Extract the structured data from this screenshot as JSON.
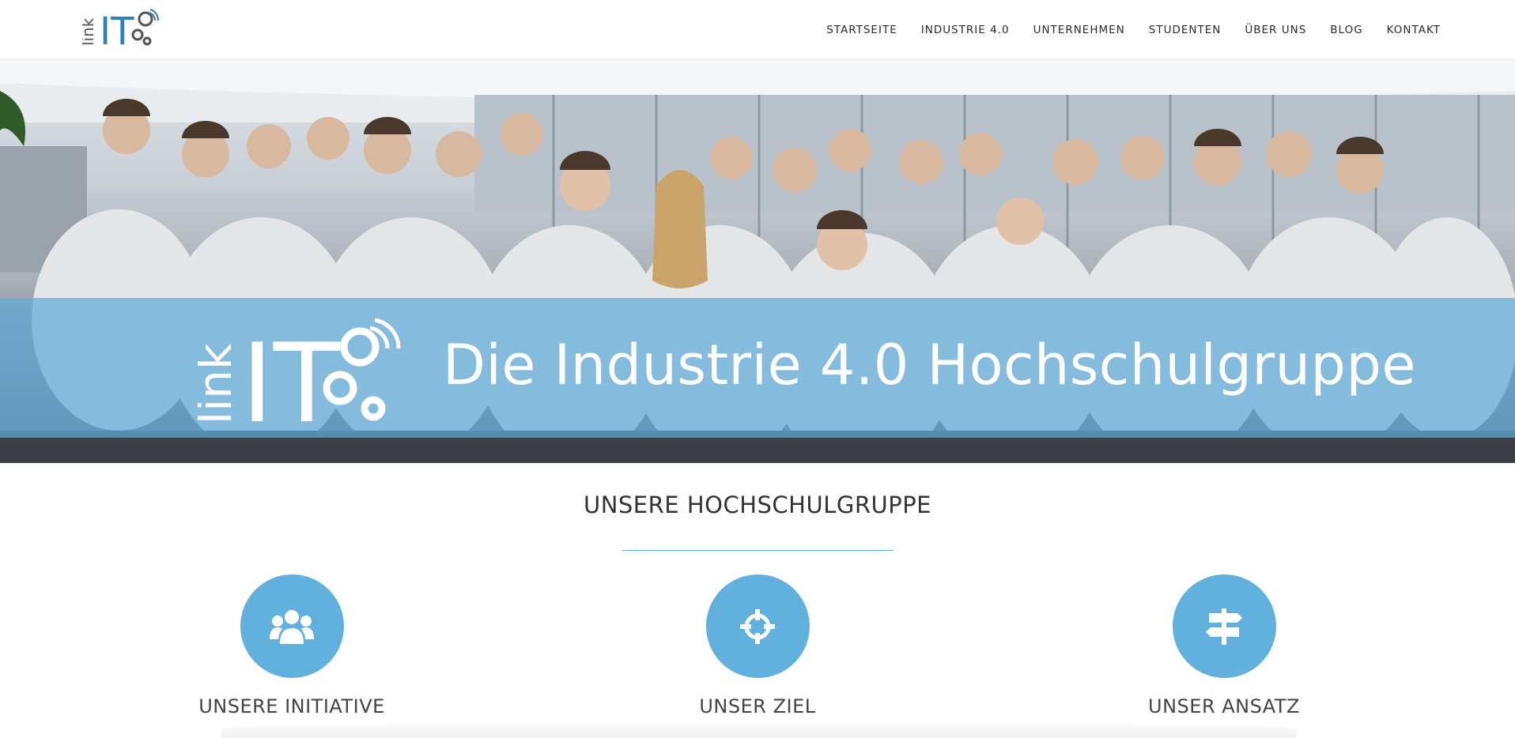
{
  "brand": {
    "logo_text_small": "link",
    "logo_text_large": "IT"
  },
  "nav": {
    "items": [
      {
        "label": "STARTSEITE"
      },
      {
        "label": "INDUSTRIE 4.0"
      },
      {
        "label": "UNTERNEHMEN"
      },
      {
        "label": "STUDENTEN"
      },
      {
        "label": "ÜBER UNS"
      },
      {
        "label": "BLOG"
      },
      {
        "label": "KONTAKT"
      }
    ]
  },
  "hero": {
    "title": "Die Industrie 4.0 Hochschulgruppe",
    "logo_text_small": "link",
    "logo_text_large": "IT"
  },
  "section": {
    "title": "UNSERE HOCHSCHULGRUPPE",
    "features": [
      {
        "label": "UNSERE INITIATIVE",
        "icon": "users-icon"
      },
      {
        "label": "UNSER ZIEL",
        "icon": "crosshairs-icon"
      },
      {
        "label": "UNSER ANSATZ",
        "icon": "signpost-icon"
      }
    ]
  },
  "colors": {
    "accent": "#62b0dd",
    "band": "#60aad8",
    "text": "#444444"
  }
}
